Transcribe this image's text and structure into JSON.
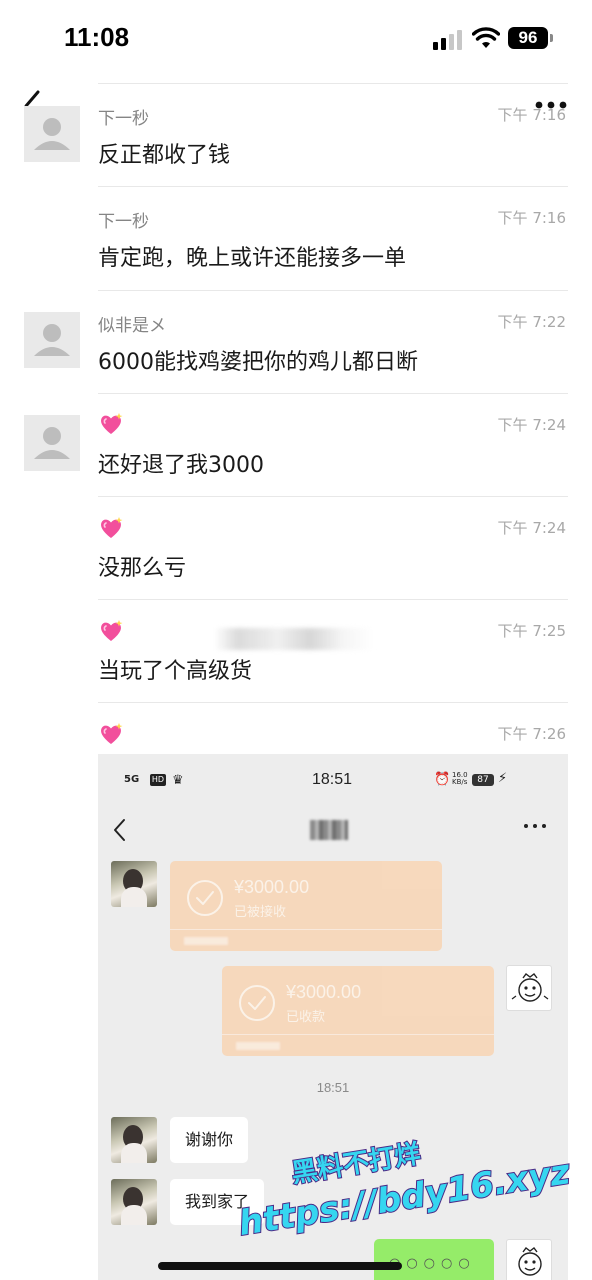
{
  "status_bar": {
    "time": "11:08",
    "battery": "96"
  },
  "icons": {
    "back": "chevron-left-icon",
    "more": "more-dots-icon",
    "avatar_placeholder": "person-silhouette-icon",
    "heart": "sparkling-heart-icon",
    "signal": "cellular-signal-icon",
    "wifi": "wifi-icon"
  },
  "messages": [
    {
      "sender": "下一秒",
      "time": "下午 7:16",
      "text": "反正都收了钱"
    },
    {
      "sender": "下一秒",
      "time": "下午 7:16",
      "text": "肯定跑，晚上或许还能接多一单"
    },
    {
      "sender": "似非是メ",
      "time": "下午 7:22",
      "text": "6000能找鸡婆把你的鸡儿都日断"
    },
    {
      "sender": "💖",
      "time": "下午 7:24",
      "text": "还好退了我3000"
    },
    {
      "sender": "💖",
      "time": "下午 7:24",
      "text": "没那么亏"
    },
    {
      "sender": "💖",
      "time": "下午 7:25",
      "text": "当玩了个高级货"
    },
    {
      "sender": "💖",
      "time": "下午 7:26"
    }
  ],
  "screenshot": {
    "status": {
      "network": "5G",
      "hd": "HD",
      "time": "18:51",
      "speed_value": "16.0",
      "speed_unit": "KB/s",
      "battery": "87"
    },
    "transfers": [
      {
        "amount": "¥3000.00",
        "status": "已被接收"
      },
      {
        "amount": "¥3000.00",
        "status": "已收款"
      }
    ],
    "center_time": "18:51",
    "bubbles": {
      "thanks": "谢谢你",
      "home": "我到家了"
    }
  },
  "watermark": {
    "line1": "黑料不打烊",
    "line2": "https://bdy16.xyz"
  },
  "colors": {
    "accent_green": "#95ec69",
    "transfer_orange": "#f9d3b0",
    "watermark_cyan": "#35d6f0"
  }
}
